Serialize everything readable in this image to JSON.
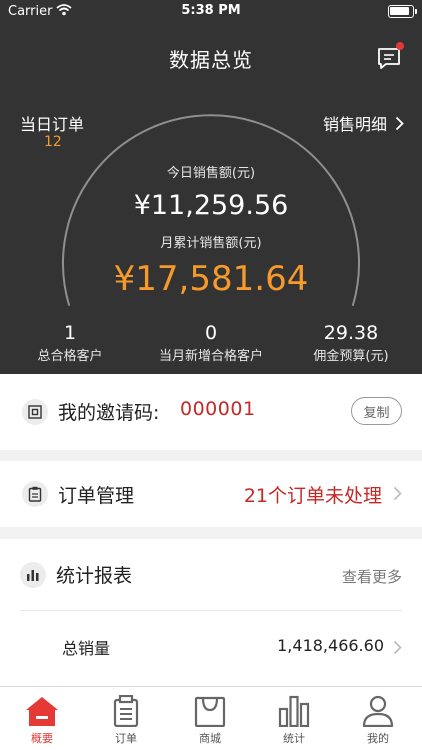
{
  "status_bar": {
    "carrier": "Carrier",
    "time": "5:38 PM"
  },
  "header": {
    "title": "数据总览",
    "daily_orders_label": "当日订单",
    "daily_orders_count": "12",
    "sales_detail_link": "销售明细",
    "today_sales_label": "今日销售额(元)",
    "today_sales_amount": "¥11,259.56",
    "month_sales_label": "月累计销售额(元)",
    "month_sales_amount": "¥17,581.64",
    "stats": [
      {
        "value": "1",
        "label": "总合格客户"
      },
      {
        "value": "0",
        "label": "当月新增合格客户"
      },
      {
        "value": "29.38",
        "label": "佣金预算(元)"
      }
    ]
  },
  "invite": {
    "label": "我的邀请码:",
    "code": "000001",
    "copy_label": "复制"
  },
  "orders": {
    "title": "订单管理",
    "pending": "21个订单未处理"
  },
  "reports": {
    "title": "统计报表",
    "see_more": "查看更多",
    "total_sales_label": "总销量",
    "total_sales_value": "1,418,466.60"
  },
  "tabbar": {
    "tabs": [
      {
        "label": "概要",
        "icon": "home-icon",
        "active": true
      },
      {
        "label": "订单",
        "icon": "clipboard-icon"
      },
      {
        "label": "商城",
        "icon": "shopping-bag-icon"
      },
      {
        "label": "统计",
        "icon": "bar-chart-icon"
      },
      {
        "label": "我的",
        "icon": "user-icon"
      }
    ]
  },
  "colors": {
    "header_bg": "#333333",
    "accent_orange": "#f59a2b",
    "accent_red": "#c62828",
    "tab_active": "#e53935"
  }
}
